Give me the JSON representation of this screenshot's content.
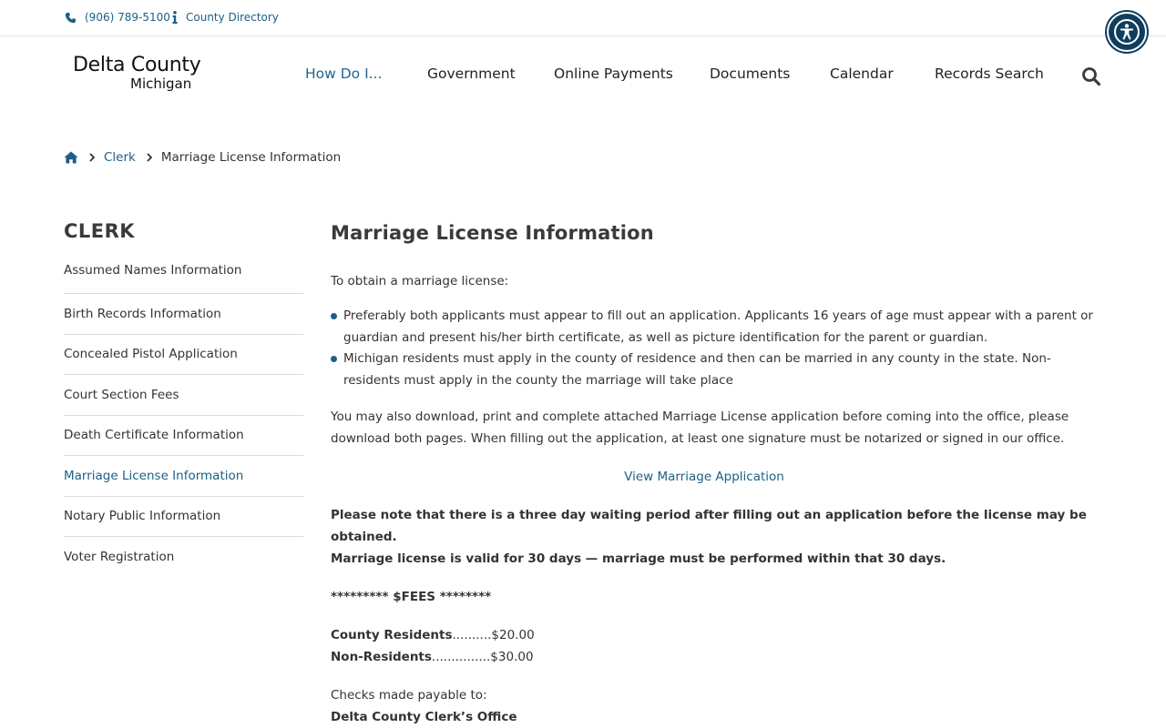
{
  "utility": {
    "phone": "(906) 789-5100",
    "directory": "County Directory"
  },
  "logo": {
    "line1": "Delta County",
    "line2": "Michigan"
  },
  "nav": {
    "items": [
      {
        "label": "How Do I..."
      },
      {
        "label": "Government"
      },
      {
        "label": "Online Payments"
      },
      {
        "label": "Documents"
      },
      {
        "label": "Calendar"
      },
      {
        "label": "Records Search"
      }
    ]
  },
  "breadcrumb": {
    "parent": "Clerk",
    "current": "Marriage License Information"
  },
  "sidebar": {
    "title": "CLERK",
    "items": [
      {
        "label": "Assumed Names Information"
      },
      {
        "label": "Birth Records Information"
      },
      {
        "label": "Concealed Pistol Application"
      },
      {
        "label": "Court Section Fees"
      },
      {
        "label": "Death Certificate Information"
      },
      {
        "label": "Marriage License Information"
      },
      {
        "label": "Notary Public Information"
      },
      {
        "label": "Voter Registration"
      }
    ]
  },
  "main": {
    "title": "Marriage License Information",
    "intro": "To obtain a marriage license:",
    "bullets": [
      "Preferably both applicants must appear to fill out an application. Applicants 16 years of age must appear with a parent or guardian and present his/her birth certificate, as well as picture identification for the parent or guardian.",
      "Michigan residents must apply in the county of residence and then can be married in any county in the state. Non-residents must apply in the county the marriage will take place"
    ],
    "download_text": "You may also download, print and complete attached Marriage License application before coming into the office, please download both pages. When filling out the application, at least one signature must be notarized or signed in our office.",
    "application_link": "View Marriage Application",
    "waiting_line1": "Please note that there is a three day waiting period after filling out an application before the license may be obtained.",
    "waiting_line2": "Marriage license is valid for 30 days — marriage must be performed within that 30 days.",
    "fees_heading": "********* $FEES ********",
    "fees": [
      {
        "label": "County Residents",
        "dots": "..........",
        "amount": "$20.00"
      },
      {
        "label": "Non-Residents",
        "dots": "...............",
        "amount": "$30.00"
      }
    ],
    "checks_label": "Checks made payable to:",
    "checks_payee": "Delta County Clerk’s Office"
  },
  "colors": {
    "link": "#1d5f86",
    "accessibility_button": "#0f3d5c",
    "heading": "#3a3a3a"
  },
  "icons": [
    "phone-icon",
    "info-icon",
    "accessibility-icon",
    "search-icon",
    "home-icon",
    "chevron-right-icon"
  ]
}
